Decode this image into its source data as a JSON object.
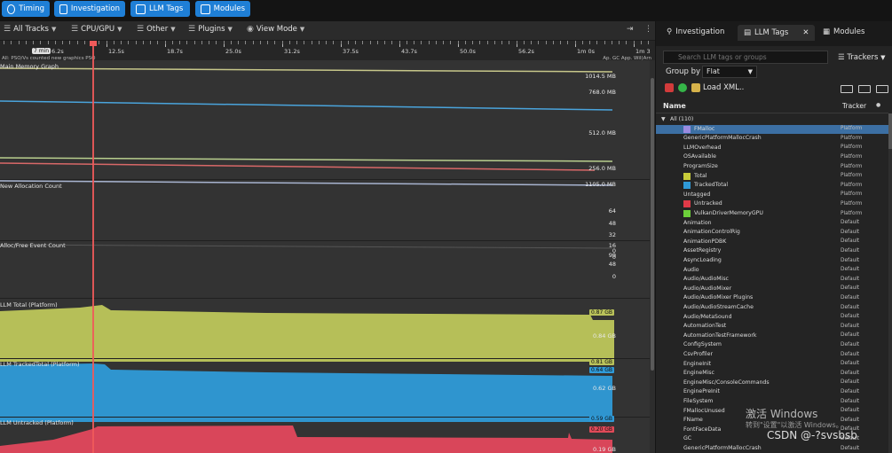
{
  "mode_tabs": [
    {
      "label": "Timing",
      "icon": "clock-icon"
    },
    {
      "label": "Investigation",
      "icon": "investigation-icon"
    },
    {
      "label": "LLM Tags",
      "icon": "tag-icon"
    },
    {
      "label": "Modules",
      "icon": "modules-icon"
    }
  ],
  "toolbar": {
    "all_tracks": "All Tracks",
    "cpu_gpu": "CPU/GPU",
    "other": "Other",
    "plugins": "Plugins",
    "view_mode": "View Mode"
  },
  "ruler": {
    "marker": "7 min",
    "marker_time": "6.2s",
    "ticks": [
      "12.5s",
      "18.7s",
      "25.0s",
      "31.2s",
      "37.5s",
      "43.7s",
      "50.0s",
      "56.2s",
      "1m 0s",
      "1m 3"
    ],
    "sub_label": "All: PSO/Vs counted new graphics PSO",
    "right_labels": "Ap. GC    App. Wil(Arn"
  },
  "tracks": [
    {
      "title": "Main Memory Graph",
      "labels": [
        "1014.5 MB",
        "768.0 MB",
        "512.0 MB",
        "256.0 MB"
      ]
    },
    {
      "title": "New Allocation Count",
      "labels": [
        "1105.0 MB",
        "64",
        "48",
        "32",
        "16",
        "0"
      ]
    },
    {
      "title": "Alloc/Free Event Count",
      "labels": [
        "0",
        "99",
        "48",
        "0"
      ]
    },
    {
      "title": "LLM Total (Platform)",
      "labels": [
        "0.87 GB",
        "0.84 GB"
      ],
      "color": "#b9c25a"
    },
    {
      "title": "LLM TrackedTotal (Platform)",
      "labels": [
        "0.81 GB",
        "0.64 GB",
        "0.62 GB"
      ],
      "color": "#2f9ad8"
    },
    {
      "title": "LLM Untracked (Platform)",
      "labels": [
        "0.59 GB",
        "0.20 GB",
        "0.19 GB"
      ],
      "color": "#e04a58"
    }
  ],
  "panel": {
    "tabs": [
      {
        "label": "Investigation",
        "icon": "investigation-icon"
      },
      {
        "label": "LLM Tags",
        "icon": "tag-icon"
      },
      {
        "label": "Modules",
        "icon": "modules-icon"
      }
    ],
    "search_placeholder": "Search LLM tags or groups",
    "trackers_btn": "Trackers",
    "group_by_label": "Group by",
    "group_by_value": "Flat",
    "load_xml": "Load XML..",
    "col_name": "Name",
    "col_tracker": "Tracker"
  },
  "tree": [
    {
      "name": "All (110)",
      "tracker": "",
      "root": true
    },
    {
      "name": "FMalloc",
      "tracker": "Platform",
      "swatch": "#9b8be0",
      "selected": true
    },
    {
      "name": "GenericPlatformMallocCrash",
      "tracker": "Platform"
    },
    {
      "name": "LLMOverhead",
      "tracker": "Platform"
    },
    {
      "name": "OSAvailable",
      "tracker": "Platform"
    },
    {
      "name": "ProgramSize",
      "tracker": "Platform"
    },
    {
      "name": "Total",
      "tracker": "Platform",
      "swatch": "#c8cc3a"
    },
    {
      "name": "TrackedTotal",
      "tracker": "Platform",
      "swatch": "#2f9ad8"
    },
    {
      "name": "Untagged",
      "tracker": "Platform"
    },
    {
      "name": "Untracked",
      "tracker": "Platform",
      "swatch": "#e03a48"
    },
    {
      "name": "VulkanDriverMemoryGPU",
      "tracker": "Platform",
      "swatch": "#6ccf3a"
    },
    {
      "name": "Animation",
      "tracker": "Default"
    },
    {
      "name": "AnimationControlRig",
      "tracker": "Default"
    },
    {
      "name": "AnimationPDBK",
      "tracker": "Default"
    },
    {
      "name": "AssetRegistry",
      "tracker": "Default"
    },
    {
      "name": "AsyncLoading",
      "tracker": "Default"
    },
    {
      "name": "Audio",
      "tracker": "Default"
    },
    {
      "name": "Audio/AudioMisc",
      "tracker": "Default"
    },
    {
      "name": "Audio/AudioMixer",
      "tracker": "Default"
    },
    {
      "name": "Audio/AudioMixer Plugins",
      "tracker": "Default"
    },
    {
      "name": "Audio/AudioStreamCache",
      "tracker": "Default"
    },
    {
      "name": "Audio/MetaSound",
      "tracker": "Default"
    },
    {
      "name": "AutomationTest",
      "tracker": "Default"
    },
    {
      "name": "AutomationTestFramework",
      "tracker": "Default"
    },
    {
      "name": "ConfigSystem",
      "tracker": "Default"
    },
    {
      "name": "CsvProfiler",
      "tracker": "Default"
    },
    {
      "name": "EngineInit",
      "tracker": "Default"
    },
    {
      "name": "EngineMisc",
      "tracker": "Default"
    },
    {
      "name": "EngineMisc/ConsoleCommands",
      "tracker": "Default"
    },
    {
      "name": "EnginePreInit",
      "tracker": "Default"
    },
    {
      "name": "FileSystem",
      "tracker": "Default"
    },
    {
      "name": "FMallocUnused",
      "tracker": "Default"
    },
    {
      "name": "FName",
      "tracker": "Default"
    },
    {
      "name": "FontFaceData",
      "tracker": "Default"
    },
    {
      "name": "GC",
      "tracker": "Default"
    },
    {
      "name": "GenericPlatformMallocCrash",
      "tracker": "Default"
    }
  ],
  "watermark": {
    "line1": "激活 Windows",
    "line2": "转到\"设置\"以激活 Windows。",
    "csdn": "CSDN @-?svsbsb"
  }
}
